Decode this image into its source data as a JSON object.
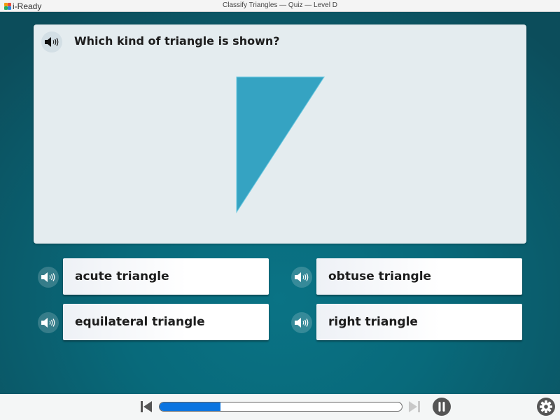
{
  "window": {
    "app_name": "i-Ready",
    "title": "Classify Triangles — Quiz — Level D"
  },
  "question": {
    "text": "Which kind of triangle is shown?",
    "audio_icon": "speaker-icon",
    "figure": {
      "shape": "triangle",
      "fill_color": "#35a3c2",
      "edge_color": "#6cc8e0"
    }
  },
  "answers": [
    {
      "label": "acute triangle",
      "audio_icon": "speaker-icon"
    },
    {
      "label": "obtuse triangle",
      "audio_icon": "speaker-icon"
    },
    {
      "label": "equilateral triangle",
      "audio_icon": "speaker-icon"
    },
    {
      "label": "right triangle",
      "audio_icon": "speaker-icon"
    }
  ],
  "footer": {
    "progress_fraction": 0.25,
    "progress_color": "#0a74e0",
    "back_icon": "skip-back-icon",
    "forward_icon": "skip-forward-icon",
    "forward_enabled": false,
    "pause_icon": "pause-icon",
    "settings_icon": "gear-icon"
  }
}
